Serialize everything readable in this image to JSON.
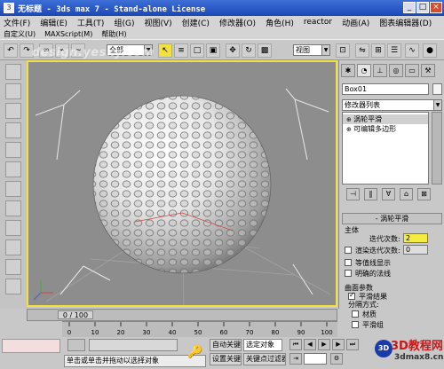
{
  "window": {
    "title": "无标题 - 3ds max 7 - Stand-alone License"
  },
  "menu": {
    "row1": [
      "文件(F)",
      "编辑(E)",
      "工具(T)",
      "组(G)",
      "视图(V)",
      "创建(C)",
      "修改器(O)",
      "角色(H)",
      "reactor",
      "动画(A)",
      "图表编辑器(D)"
    ],
    "row2": [
      "自定义(U)",
      "MAXScript(M)",
      "帮助(H)"
    ]
  },
  "toolbar": {
    "selection_filter": "全部",
    "ref_coord": "视图"
  },
  "watermark": "design.yesky.com",
  "command_panel": {
    "object_name": "Box01",
    "modifier_list": "修改器列表",
    "stack": [
      {
        "label": "涡轮平滑",
        "selected": true
      },
      {
        "label": "可编辑多边形",
        "selected": false
      }
    ],
    "rollout_title": "涡轮平滑",
    "main_group": "主体",
    "iterations_label": "迭代次数:",
    "iterations_value": "2",
    "render_iters_label": "渲染迭代次数:",
    "render_iters_value": "0",
    "isoline_label": "等值线显示",
    "explicit_normals_label": "明确的法线",
    "surface_params_label": "曲面参数",
    "smooth_result_label": "平滑结果",
    "separate_label": "分隔方式:",
    "materials_label": "材质",
    "smoothing_groups_label": "平滑组"
  },
  "timeline": {
    "frame_text": "0 / 100",
    "ticks": [
      "0",
      "10",
      "20",
      "30",
      "40",
      "50",
      "60",
      "70",
      "80",
      "90",
      "100"
    ]
  },
  "status": {
    "prompt": "单击或单击并拖动以选择对象",
    "auto_key": "自动关键点",
    "set_key": "设置关键点",
    "selected_label": "选定对象",
    "key_filters": "关键点过滤器..."
  },
  "logo": {
    "main": "3D教程网",
    "sub": "3dmax8.cn"
  },
  "colors": {
    "viewport_bg": "#8d8d8d",
    "active_border": "#f0e040",
    "titlebar": "#2855c6"
  }
}
